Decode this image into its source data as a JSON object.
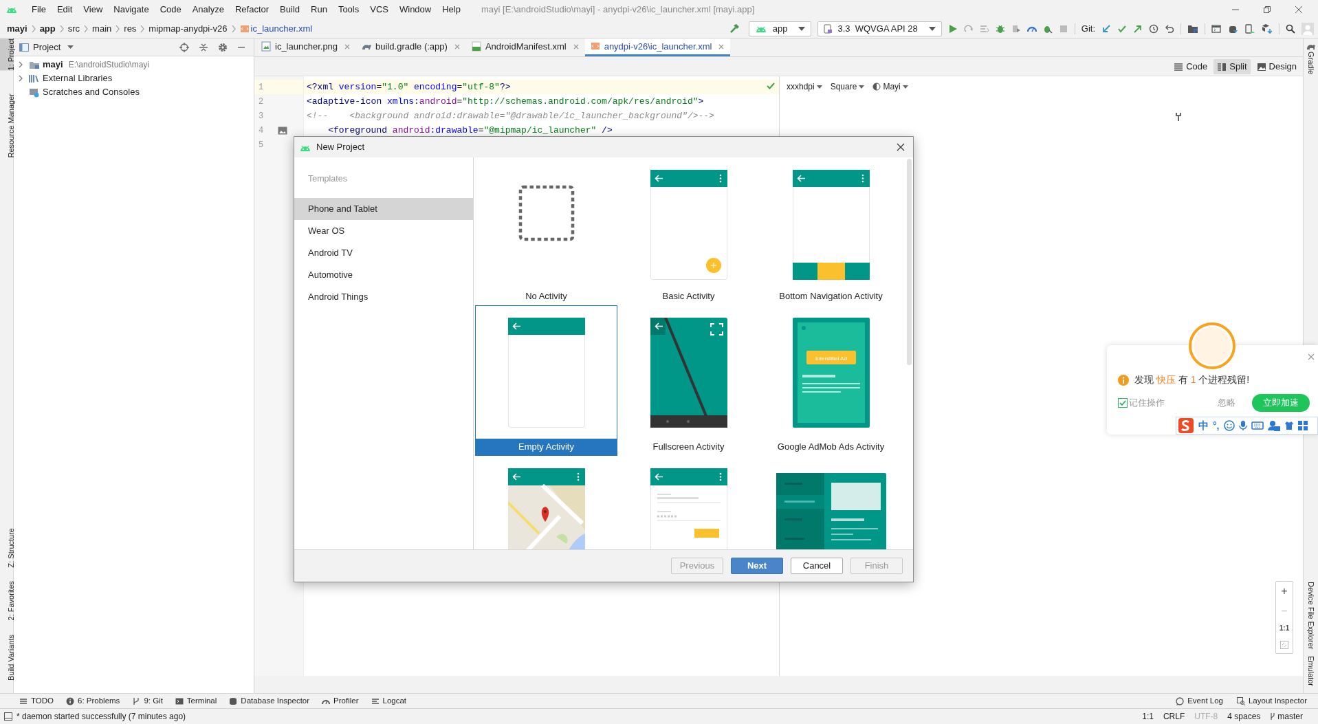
{
  "title_bar": {
    "menus": [
      "File",
      "Edit",
      "View",
      "Navigate",
      "Code",
      "Analyze",
      "Refactor",
      "Build",
      "Run",
      "Tools",
      "VCS",
      "Window",
      "Help"
    ],
    "title": "mayi [E:\\androidStudio\\mayi] - anydpi-v26\\ic_launcher.xml [mayi.app]"
  },
  "breadcrumb": [
    {
      "label": "mayi",
      "bold": true
    },
    {
      "label": "app",
      "bold": true
    },
    {
      "label": "src",
      "bold": false
    },
    {
      "label": "main",
      "bold": false
    },
    {
      "label": "res",
      "bold": false
    },
    {
      "label": "mipmap-anydpi-v26",
      "bold": false
    },
    {
      "label": "ic_launcher.xml",
      "bold": false,
      "file": true
    }
  ],
  "toolbar": {
    "run_config": "app",
    "device": "3.3  WQVGA API 28",
    "git_label": "Git:"
  },
  "left_strip": {
    "top": [
      {
        "label": "1: Project",
        "selected": true
      },
      {
        "label": "Resource Manager",
        "selected": false
      }
    ],
    "bottom": [
      {
        "label": "Z: Structure",
        "selected": false
      },
      {
        "label": "2: Favorites",
        "selected": false
      },
      {
        "label": "Build Variants",
        "selected": false
      }
    ]
  },
  "right_strip": {
    "top": [
      "Gradle"
    ],
    "bottom": [
      "Device File Explorer",
      "Emulator"
    ]
  },
  "project_panel": {
    "title": "Project",
    "tree": [
      {
        "kind": "module",
        "label": "mayi",
        "path": "E:\\androidStudio\\mayi",
        "expandable": true
      },
      {
        "kind": "library",
        "label": "External Libraries",
        "expandable": true
      },
      {
        "kind": "scratch",
        "label": "Scratches and Consoles",
        "expandable": false
      }
    ]
  },
  "editor_tabs": [
    {
      "kind": "png",
      "label": "ic_launcher.png",
      "selected": false
    },
    {
      "kind": "gradle",
      "label": "build.gradle (:app)",
      "selected": false
    },
    {
      "kind": "manifest",
      "label": "AndroidManifest.xml",
      "selected": false
    },
    {
      "kind": "xml",
      "label": "anydpi-v26\\ic_launcher.xml",
      "selected": true
    }
  ],
  "view_modes": [
    {
      "kind": "code",
      "label": "Code",
      "selected": false
    },
    {
      "kind": "split",
      "label": "Split",
      "selected": true
    },
    {
      "kind": "design",
      "label": "Design",
      "selected": false
    }
  ],
  "code_lines": [
    {
      "number": "1",
      "current": true,
      "tokens": [
        {
          "kind": "tag",
          "text": "<?xml"
        },
        {
          "kind": "attr",
          "text": " version"
        },
        {
          "kind": "plain",
          "text": "="
        },
        {
          "kind": "value",
          "text": "\"1.0\""
        },
        {
          "kind": "attr",
          "text": " encoding"
        },
        {
          "kind": "plain",
          "text": "="
        },
        {
          "kind": "value",
          "text": "\"utf-8\""
        },
        {
          "kind": "tag",
          "text": "?>"
        }
      ]
    },
    {
      "number": "2",
      "current": false,
      "tokens": [
        {
          "kind": "tag",
          "text": "<adaptive-icon"
        },
        {
          "kind": "attr",
          "text": " xmlns:"
        },
        {
          "kind": "ns",
          "text": "android"
        },
        {
          "kind": "plain",
          "text": "="
        },
        {
          "kind": "value",
          "text": "\"http://schemas.android.com/apk/res/android\""
        },
        {
          "kind": "tag",
          "text": ">"
        }
      ]
    },
    {
      "number": "3",
      "current": false,
      "tokens": [
        {
          "kind": "comment",
          "text": "<!--    <background android:drawable=\"@drawable/ic_launcher_background\"/>-->"
        }
      ]
    },
    {
      "number": "4",
      "current": false,
      "tokens": [
        {
          "kind": "tag",
          "text": "    <foreground"
        },
        {
          "kind": "ns",
          "text": " android"
        },
        {
          "kind": "attr",
          "text": ":drawable"
        },
        {
          "kind": "plain",
          "text": "="
        },
        {
          "kind": "value",
          "text": "\"@mipmap/ic_launcher\""
        },
        {
          "kind": "tag",
          "text": " />"
        }
      ]
    },
    {
      "number": "5",
      "current": false
    }
  ],
  "preview_toolbar": [
    "xxxhdpi",
    "Square",
    "Mayi"
  ],
  "dialog": {
    "title": "New Project",
    "sidebar_heading": "Templates",
    "categories": [
      {
        "label": "Phone and Tablet",
        "selected": true
      },
      {
        "label": "Wear OS",
        "selected": false
      },
      {
        "label": "Android TV",
        "selected": false
      },
      {
        "label": "Automotive",
        "selected": false
      },
      {
        "label": "Android Things",
        "selected": false
      }
    ],
    "templates": [
      {
        "kind": "none",
        "label": "No Activity",
        "selected": false
      },
      {
        "kind": "basic",
        "label": "Basic Activity",
        "selected": false
      },
      {
        "kind": "bottom_nav",
        "label": "Bottom Navigation Activity",
        "selected": false
      },
      {
        "kind": "empty",
        "label": "Empty Activity",
        "selected": true
      },
      {
        "kind": "fullscreen",
        "label": "Fullscreen Activity",
        "selected": false
      },
      {
        "kind": "admob",
        "label": "Google AdMob Ads Activity",
        "badge": "Interstitial Ad",
        "selected": false
      },
      {
        "kind": "maps",
        "selected": false
      },
      {
        "kind": "login",
        "selected": false
      },
      {
        "kind": "master_detail",
        "selected": false
      }
    ],
    "buttons": [
      {
        "label": "Previous",
        "kind": "default",
        "disabled": true
      },
      {
        "label": "Next",
        "kind": "primary",
        "disabled": false
      },
      {
        "label": "Cancel",
        "kind": "default",
        "disabled": false
      },
      {
        "label": "Finish",
        "kind": "default",
        "disabled": true
      }
    ]
  },
  "zoom_controls": {
    "zoom_in": "+",
    "zoom_out": "−",
    "actual_size": "1:1"
  },
  "popup": {
    "message": [
      {
        "text": "发现 ",
        "highlight": false
      },
      {
        "text": "快压",
        "highlight": true
      },
      {
        "text": " 有 ",
        "highlight": false
      },
      {
        "text": "1",
        "highlight": true
      },
      {
        "text": " 个进程残留!",
        "highlight": false
      }
    ],
    "remember": {
      "label": "记住操作",
      "checked": true
    },
    "ignore": "忽略",
    "action": "立即加速"
  },
  "ime_bar": {
    "mode": "中",
    "punctuation": "°,"
  },
  "tool_windows": {
    "left": [
      {
        "kind": "todo",
        "label": "TODO"
      },
      {
        "kind": "problems",
        "label": "6: Problems"
      },
      {
        "kind": "git",
        "label": "9: Git"
      },
      {
        "kind": "terminal",
        "label": "Terminal"
      },
      {
        "kind": "database",
        "label": "Database Inspector"
      },
      {
        "kind": "profiler",
        "label": "Profiler"
      },
      {
        "kind": "logcat",
        "label": "Logcat"
      }
    ],
    "right": [
      {
        "kind": "event",
        "label": "Event Log"
      },
      {
        "kind": "layout",
        "label": "Layout Inspector"
      }
    ]
  },
  "status_bar": {
    "message": "* daemon started successfully (7 minutes ago)",
    "items": [
      {
        "label": "1:1",
        "muted": false
      },
      {
        "label": "CRLF",
        "muted": false
      },
      {
        "label": "UTF-8",
        "muted": true
      },
      {
        "label": "4 spaces",
        "muted": false
      },
      {
        "label": "master",
        "muted": false,
        "branch": true
      }
    ]
  }
}
